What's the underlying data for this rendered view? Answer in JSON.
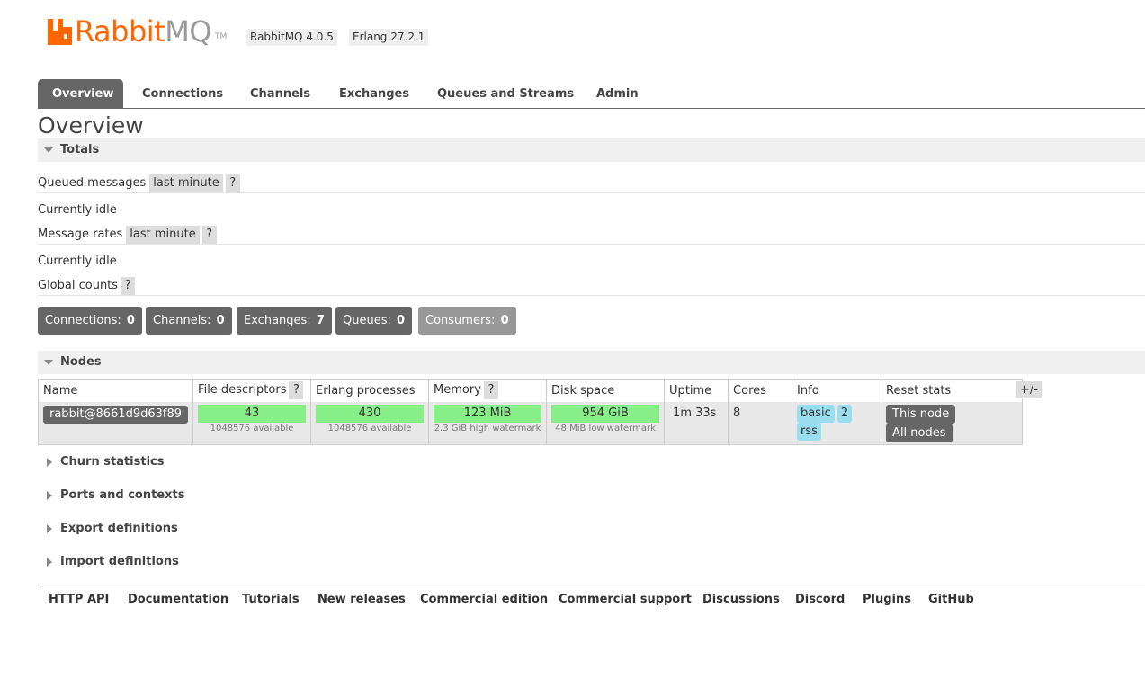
{
  "header": {
    "logo_rabbit": "Rabbit",
    "logo_mq": "MQ",
    "logo_tm": "TM",
    "rabbitmq_version": "RabbitMQ 4.0.5",
    "erlang_version": "Erlang 27.2.1"
  },
  "tabs": [
    {
      "label": "Overview",
      "active": true
    },
    {
      "label": "Connections",
      "active": false
    },
    {
      "label": "Channels",
      "active": false
    },
    {
      "label": "Exchanges",
      "active": false
    },
    {
      "label": "Queues and Streams",
      "active": false
    },
    {
      "label": "Admin",
      "active": false
    }
  ],
  "page_title": "Overview",
  "totals": {
    "title": "Totals",
    "queued_messages_label": "Queued messages",
    "queued_messages_range": "last minute",
    "queued_status": "Currently idle",
    "message_rates_label": "Message rates",
    "message_rates_range": "last minute",
    "rates_status": "Currently idle",
    "global_counts_label": "Global counts",
    "help": "?"
  },
  "counts": [
    {
      "label": "Connections:",
      "value": "0"
    },
    {
      "label": "Channels:",
      "value": "0"
    },
    {
      "label": "Exchanges:",
      "value": "7"
    },
    {
      "label": "Queues:",
      "value": "0"
    },
    {
      "label": "Consumers:",
      "value": "0"
    }
  ],
  "nodes": {
    "title": "Nodes",
    "columns": [
      "Name",
      "File descriptors",
      "Erlang processes",
      "Memory",
      "Disk space",
      "Uptime",
      "Cores",
      "Info",
      "Reset stats"
    ],
    "toggle_columns": "+/-",
    "row": {
      "name": "rabbit@8661d9d63f89",
      "file_descriptors": "43",
      "file_descriptors_sub": "1048576 available",
      "erlang_processes": "430",
      "erlang_processes_sub": "1048576 available",
      "memory": "123 MiB",
      "memory_sub": "2.3 GiB high watermark",
      "disk_space": "954 GiB",
      "disk_space_sub": "48 MiB low watermark",
      "uptime": "1m 33s",
      "cores": "8",
      "info": [
        "basic",
        "2",
        "rss"
      ],
      "reset_this_node": "This node",
      "reset_all_nodes": "All nodes"
    }
  },
  "collapsed_sections": [
    "Churn statistics",
    "Ports and contexts",
    "Export definitions",
    "Import definitions"
  ],
  "footer_links": [
    "HTTP API",
    "Documentation",
    "Tutorials",
    "New releases",
    "Commercial edition",
    "Commercial support",
    "Discussions",
    "Discord",
    "Plugins",
    "GitHub"
  ],
  "colors": {
    "brand_orange": "#ff6600",
    "tab_active": "#666666",
    "gauge_ok": "#88ee88",
    "info_badge": "#99ddee"
  }
}
